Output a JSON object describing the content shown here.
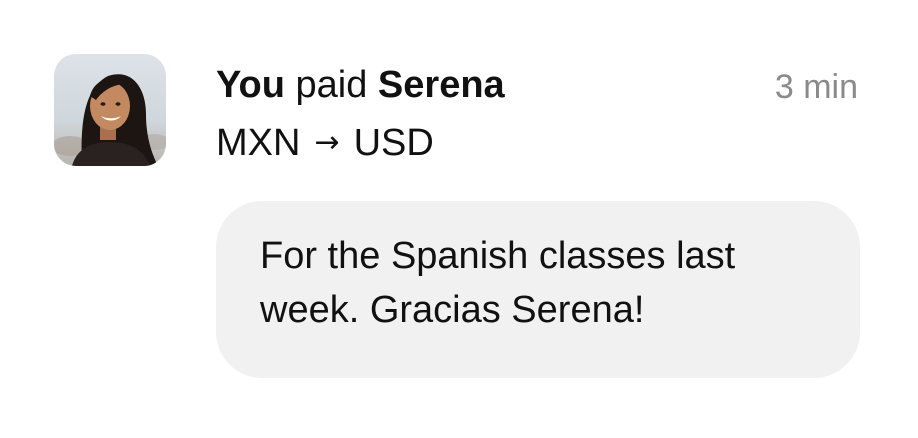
{
  "payment": {
    "actor": "You",
    "verb": "paid",
    "recipient": "Serena",
    "timestamp": "3 min",
    "from_currency": "MXN",
    "arrow": "→",
    "to_currency": "USD"
  },
  "message": {
    "text": "For the Spanish classes last week. Gracias Serena!"
  },
  "avatar": {
    "icon": "person-photo"
  }
}
